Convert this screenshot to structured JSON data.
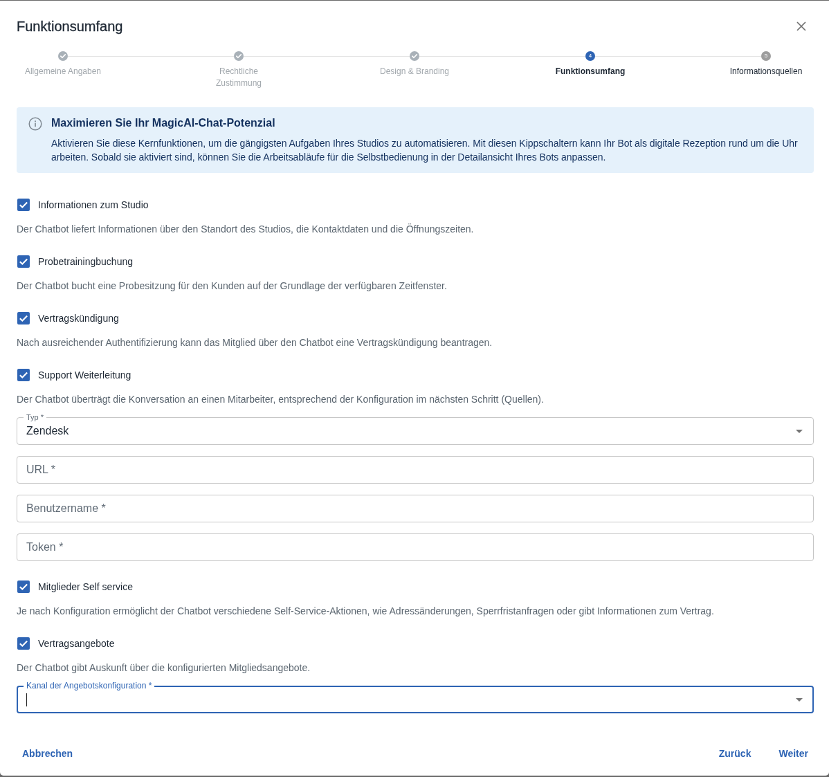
{
  "dialog": {
    "title": "Funktionsumfang"
  },
  "stepper": {
    "steps": [
      {
        "label": "Allgemeine Angaben",
        "completed": true,
        "selected": false
      },
      {
        "label": "Rechtliche Zustimmung",
        "completed": true,
        "selected": false
      },
      {
        "label": "Design & Branding",
        "completed": true,
        "selected": false
      },
      {
        "label": "Funktionsumfang",
        "number": "4",
        "completed": false,
        "selected": true
      },
      {
        "label": "Informationsquellen",
        "number": "5",
        "completed": false,
        "selected": false
      }
    ]
  },
  "info_banner": {
    "title": "Maximieren Sie Ihr MagicAI-Chat-Potenzial",
    "text": "Aktivieren Sie diese Kernfunktionen, um die gängigsten Aufgaben Ihres Studios zu automatisieren. Mit diesen Kippschaltern kann Ihr Bot als digitale Rezeption rund um die Uhr arbeiten. Sobald sie aktiviert sind, können Sie die Arbeitsabläufe für die Selbstbedienung in der Detailansicht Ihres Bots anpassen."
  },
  "features": [
    {
      "label": "Informationen zum Studio",
      "checked": true,
      "description": "Der Chatbot liefert Informationen über den Standort des Studios, die Kontaktdaten und die Öffnungszeiten."
    },
    {
      "label": "Probetrainingbuchung",
      "checked": true,
      "description": "Der Chatbot bucht eine Probesitzung für den Kunden auf der Grundlage der verfügbaren Zeitfenster."
    },
    {
      "label": "Vertragskündigung",
      "checked": true,
      "description": "Nach ausreichender Authentifizierung kann das Mitglied über den Chatbot eine Vertragskündigung beantragen."
    },
    {
      "label": "Support Weiterleitung",
      "checked": true,
      "description": "Der Chatbot überträgt die Konversation an einen Mitarbeiter, entsprechend der Konfiguration im nächsten Schritt (Quellen).",
      "fields": [
        {
          "kind": "select",
          "label": "Typ *",
          "value": "Zendesk",
          "focused": false
        },
        {
          "kind": "text",
          "label": "URL *",
          "focused": false
        },
        {
          "kind": "text",
          "label": "Benutzername *",
          "focused": false
        },
        {
          "kind": "text",
          "label": "Token *",
          "focused": false
        }
      ]
    },
    {
      "label": "Mitglieder Self service",
      "checked": true,
      "description": "Je nach Konfiguration ermöglicht der Chatbot verschiedene Self-Service-Aktionen, wie Adressänderungen, Sperrfristanfragen oder gibt Informationen zum Vertrag."
    },
    {
      "label": "Vertragsangebote",
      "checked": true,
      "description": "Der Chatbot gibt Auskunft über die konfigurierten Mitgliedsangebote.",
      "fields": [
        {
          "kind": "select",
          "label": "Kanal der Angebotskonfiguration *",
          "focused": true
        }
      ]
    }
  ],
  "footer": {
    "cancel": "Abbrechen",
    "back": "Zurück",
    "next": "Weiter"
  }
}
